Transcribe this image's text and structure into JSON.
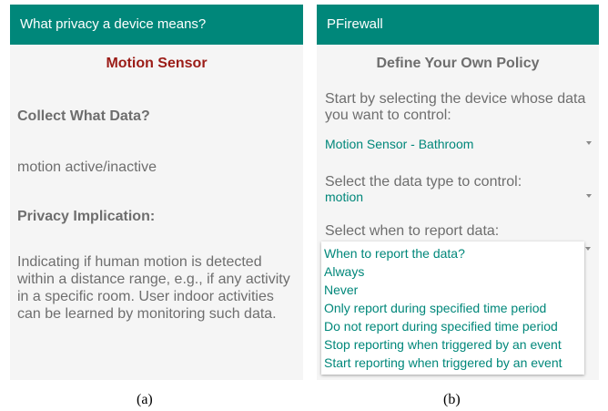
{
  "panel_a": {
    "appbar_title": "What privacy a device means?",
    "device_title": "Motion Sensor",
    "collect_heading": "Collect What Data?",
    "collect_value": "motion active/inactive",
    "privacy_heading": "Privacy Implication:",
    "privacy_text": "Indicating if human motion is detected within a distance range, e.g., if any activity in a specific room. User indoor activities can be learned by monitoring such data.",
    "caption": "(a)"
  },
  "panel_b": {
    "appbar_title": "PFirewall",
    "section_title": "Define Your Own Policy",
    "device_label": "Start by selecting the device whose data you want to control:",
    "device_select": "Motion Sensor - Bathroom",
    "datatype_label": "Select the data type to control:",
    "datatype_select": "motion",
    "when_label": "Select when to report data:",
    "when_options": [
      "When to report the data?",
      "Always",
      "Never",
      "Only report during specified time period",
      "Do not report during specified time period",
      "Stop reporting when triggered by an event",
      "Start reporting when triggered by an event"
    ],
    "caption": "(b)"
  },
  "colors": {
    "appbar": "#00877a",
    "accent_text": "#00877a",
    "device_title": "#9b1c17",
    "body_text": "#6e6e6e"
  }
}
